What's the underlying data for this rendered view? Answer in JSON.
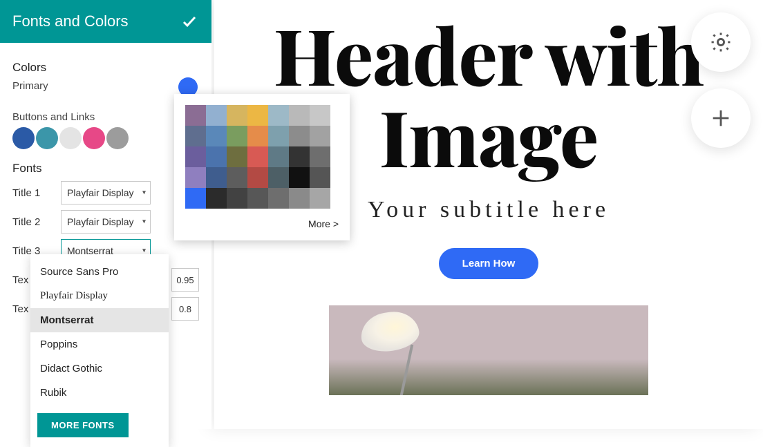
{
  "panel": {
    "title": "Fonts and Colors",
    "sections": {
      "colors_label": "Colors",
      "primary_label": "Primary",
      "primary_value": "#2f6af5",
      "buttons_links_label": "Buttons and  Links",
      "button_colors": [
        "#2b5aa6",
        "#3b96a9",
        "#e4e4e4",
        "#e74887",
        "#9c9c9c"
      ],
      "fonts_label": "Fonts",
      "font_rows": [
        {
          "label": "Title 1",
          "font": "Playfair Display",
          "size": ""
        },
        {
          "label": "Title 2",
          "font": "Playfair Display",
          "size": ""
        },
        {
          "label": "Title 3",
          "font": "Montserrat",
          "size": ""
        },
        {
          "label": "Tex",
          "font": "",
          "size": "0.95"
        },
        {
          "label": "Tex",
          "font": "",
          "size": "0.8"
        }
      ]
    }
  },
  "color_picker": {
    "cells": [
      "#8b6d94",
      "#92b0d0",
      "#d6b55f",
      "#ecb744",
      "#9db9c7",
      "#b9b9b9",
      "#c7c7c7",
      "#5f6e8f",
      "#5a88b9",
      "#7a9d5f",
      "#e58c4a",
      "#7ea0ad",
      "#8c8c8c",
      "#a2a2a2",
      "#6b5e9d",
      "#4b73ad",
      "#6e6e3f",
      "#d85a54",
      "#5f7a86",
      "#333333",
      "#6e6e6e",
      "#8f7fbf",
      "#3f5d8e",
      "#5d5d5d",
      "#b34a44",
      "#4d5f66",
      "#111111",
      "#555555",
      "#2f6af5",
      "#2b2b2b",
      "#424242",
      "#575757",
      "#6e6e6e",
      "#8a8a8a",
      "#a6a6a6"
    ],
    "more_label": "More >"
  },
  "font_dropdown": {
    "options": [
      "Source Sans Pro",
      "Playfair Display",
      "Montserrat",
      "Poppins",
      "Didact Gothic",
      "Rubik"
    ],
    "selected": "Montserrat",
    "more_fonts_label": "MORE FONTS"
  },
  "canvas": {
    "heading_line1": "Header with",
    "heading_line2": "Image",
    "subtitle": "Your subtitle here",
    "cta_label": "Learn How"
  },
  "fabs": {
    "settings": "settings-icon",
    "add": "plus-icon"
  }
}
